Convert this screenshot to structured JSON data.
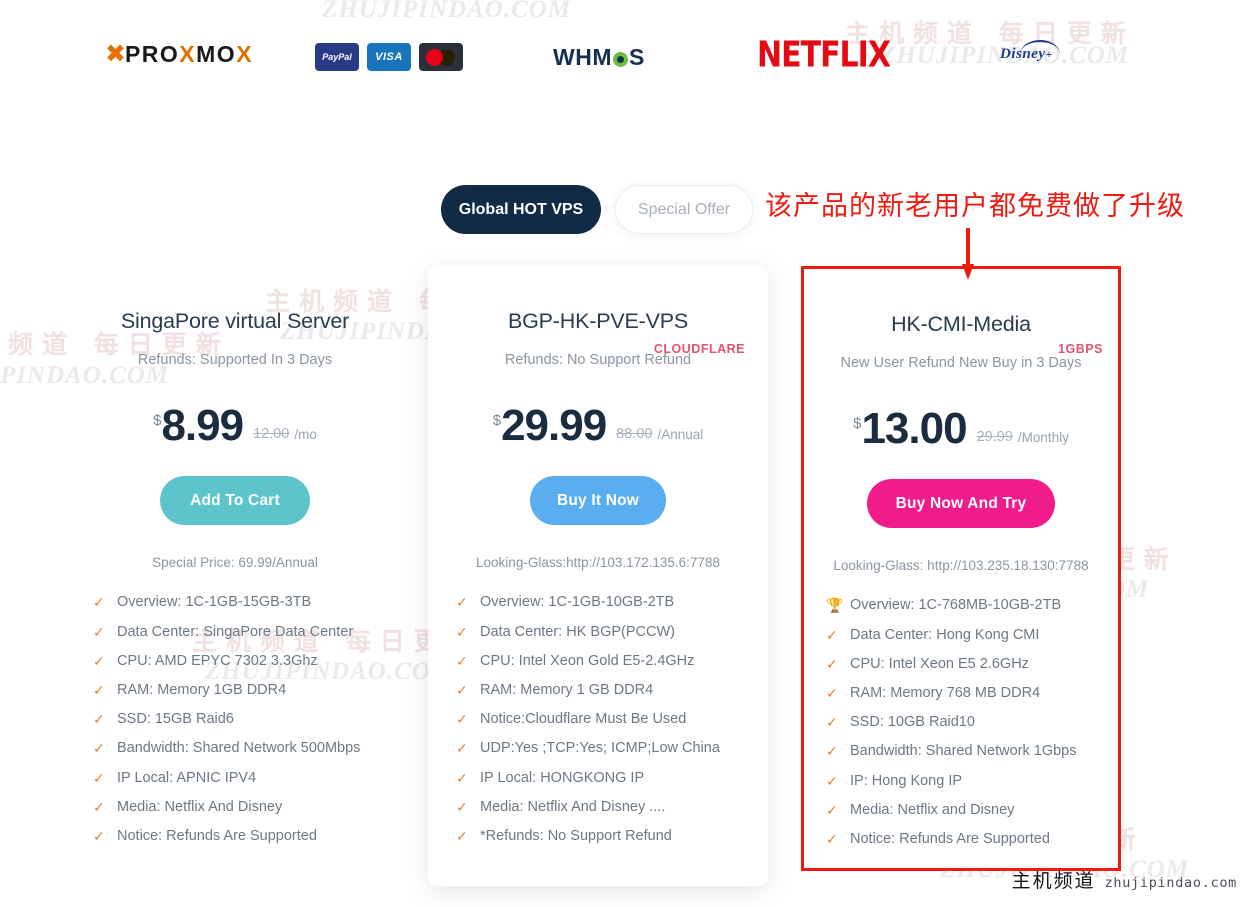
{
  "brands": {
    "proxmox": {
      "mark": "X",
      "text_pro": "PRO",
      "text_x": "X",
      "text_mo": "MO",
      "text_x2": "X",
      "full": "PROXMOX"
    },
    "payments": [
      {
        "name": "paypal",
        "label": "PayPal"
      },
      {
        "name": "visa",
        "label": "VISA"
      },
      {
        "name": "mastercard",
        "label": ""
      }
    ],
    "whmcs": {
      "pre": "WHM",
      "post": "S"
    },
    "netflix": "NETFLIX",
    "disney": {
      "word": "Disney",
      "plus": "+"
    }
  },
  "toggle": {
    "active_label": "Global HOT VPS",
    "inactive_label": "Special Offer"
  },
  "annotation": {
    "text": "该产品的新老用户都免费做了升级",
    "color": "#ee1b11"
  },
  "watermarks": {
    "cn": "主机频道 每日更新",
    "en": "ZHUJIPINDAO.COM"
  },
  "cards": [
    {
      "id": "singapore",
      "badge": "",
      "title": "SingaPore virtual Server",
      "subtitle": "Refunds: Supported In 3 Days",
      "currency": "$",
      "price": "8.99",
      "old_price": "12.00",
      "period": "/mo",
      "cta": "Add To Cart",
      "cta_color": "#5ec4cb",
      "note": "Special Price: 69.99/Annual",
      "features": [
        {
          "icon": "check-icon",
          "text": "Overview: 1C-1GB-15GB-3TB"
        },
        {
          "icon": "check-icon",
          "text": "Data Center: SingaPore Data Center"
        },
        {
          "icon": "check-icon",
          "text": "CPU: AMD EPYC 7302 3.3Ghz"
        },
        {
          "icon": "check-icon",
          "text": "RAM: Memory 1GB DDR4"
        },
        {
          "icon": "check-icon",
          "text": "SSD: 15GB Raid6"
        },
        {
          "icon": "check-icon",
          "text": "Bandwidth: Shared Network 500Mbps"
        },
        {
          "icon": "check-icon",
          "text": "IP Local: APNIC IPV4"
        },
        {
          "icon": "check-icon",
          "text": "Media: Netflix And Disney"
        },
        {
          "icon": "check-icon",
          "text": "Notice: Refunds Are Supported"
        }
      ]
    },
    {
      "id": "bgp-hk-pve",
      "badge": "CLOUDFLARE",
      "title": "BGP-HK-PVE-VPS",
      "subtitle": "Refunds: No Support Refund",
      "currency": "$",
      "price": "29.99",
      "old_price": "88.00",
      "period": "/Annual",
      "cta": "Buy It Now",
      "cta_color": "#5aaeef",
      "note": "Looking-Glass:http://103.172.135.6:7788",
      "features": [
        {
          "icon": "check-icon",
          "text": "Overview: 1C-1GB-10GB-2TB"
        },
        {
          "icon": "check-icon",
          "text": "Data Center: HK BGP(PCCW)"
        },
        {
          "icon": "check-icon",
          "text": "CPU: Intel Xeon Gold E5-2.4GHz"
        },
        {
          "icon": "check-icon",
          "text": "RAM: Memory 1 GB DDR4"
        },
        {
          "icon": "check-icon",
          "text": "Notice:Cloudflare Must Be Used"
        },
        {
          "icon": "check-icon",
          "text": "UDP:Yes ;TCP:Yes; ICMP;Low China"
        },
        {
          "icon": "check-icon",
          "text": "IP Local: HONGKONG IP"
        },
        {
          "icon": "check-icon",
          "text": "Media: Netflix And Disney ...."
        },
        {
          "icon": "check-icon",
          "text": "*Refunds: No Support Refund"
        }
      ]
    },
    {
      "id": "hk-cmi-media",
      "badge": "1GBPS",
      "title": "HK-CMI-Media",
      "subtitle": "New User Refund New Buy in 3 Days",
      "currency": "$",
      "price": "13.00",
      "old_price": "29.99",
      "period": "/Monthly",
      "cta": "Buy Now And Try",
      "cta_color": "#f01c8b",
      "note": "Looking-Glass: http://103.235.18.130:7788",
      "features": [
        {
          "icon": "trophy-icon",
          "text": "Overview: 1C-768MB-10GB-2TB"
        },
        {
          "icon": "check-icon",
          "text": "Data Center: Hong Kong CMI"
        },
        {
          "icon": "check-icon",
          "text": "CPU: Intel Xeon E5 2.6GHz"
        },
        {
          "icon": "check-icon",
          "text": "RAM: Memory 768 MB DDR4"
        },
        {
          "icon": "check-icon",
          "text": "SSD: 10GB Raid10"
        },
        {
          "icon": "check-icon",
          "text": "Bandwidth: Shared Network 1Gbps"
        },
        {
          "icon": "check-icon",
          "text": "IP: Hong Kong IP"
        },
        {
          "icon": "check-icon",
          "text": "Media: Netflix and Disney"
        },
        {
          "icon": "check-icon",
          "text": "Notice: Refunds Are Supported"
        }
      ]
    }
  ],
  "footer": {
    "cn": "主机频道",
    "en": "zhujipindao.com"
  }
}
